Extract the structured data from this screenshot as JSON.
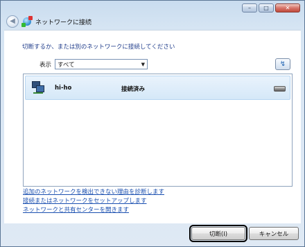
{
  "window": {
    "title": "ネットワークに接続",
    "controls": {
      "minimize": "–",
      "maximize": "□",
      "close": "✕"
    },
    "back_glyph": "◀"
  },
  "main": {
    "instruction": "切断するか、または別のネットワークに接続してください",
    "filter_label": "表示",
    "filter_value": "すべて",
    "filter_chevron": "▼",
    "refresh_glyph": "↯",
    "networks": [
      {
        "name": "hi-ho",
        "status": "接続済み",
        "icon": "dialup-network-icon",
        "signal_icon": "modem-icon"
      }
    ]
  },
  "links": [
    "追加のネットワークを検出できない理由を診断します",
    "接続またはネットワークをセットアップします",
    "ネットワークと共有センターを開きます"
  ],
  "buttons": {
    "disconnect": "切断(I)",
    "cancel": "キャンセル"
  },
  "colors": {
    "accent": "#1a4fb0",
    "selection": "#d5e8f8",
    "window_frame": "#c9dcef"
  }
}
